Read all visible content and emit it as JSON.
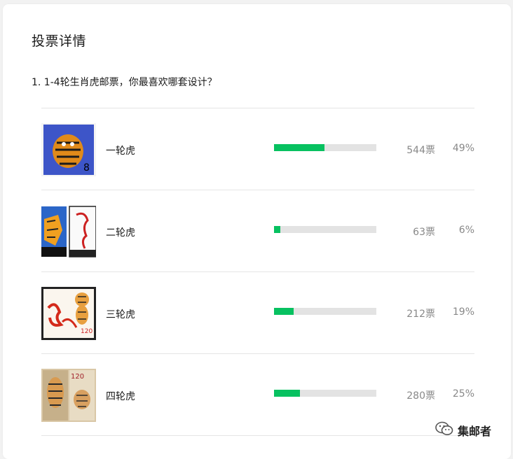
{
  "page": {
    "title": "投票详情"
  },
  "question": {
    "text": "1. 1-4轮生肖虎邮票，你最喜欢哪套设计？"
  },
  "options": [
    {
      "label": "一轮虎",
      "votes": "544票",
      "percent": "49%",
      "fill": 0.49
    },
    {
      "label": "二轮虎",
      "votes": "63票",
      "percent": "6%",
      "fill": 0.06
    },
    {
      "label": "三轮虎",
      "votes": "212票",
      "percent": "19%",
      "fill": 0.19
    },
    {
      "label": "四轮虎",
      "votes": "280票",
      "percent": "25%",
      "fill": 0.25
    }
  ],
  "watermark": {
    "text": "集邮者",
    "icon": "wechat-icon"
  },
  "colors": {
    "accent": "#07c160",
    "track": "#e3e3e3",
    "muted": "#888888"
  }
}
